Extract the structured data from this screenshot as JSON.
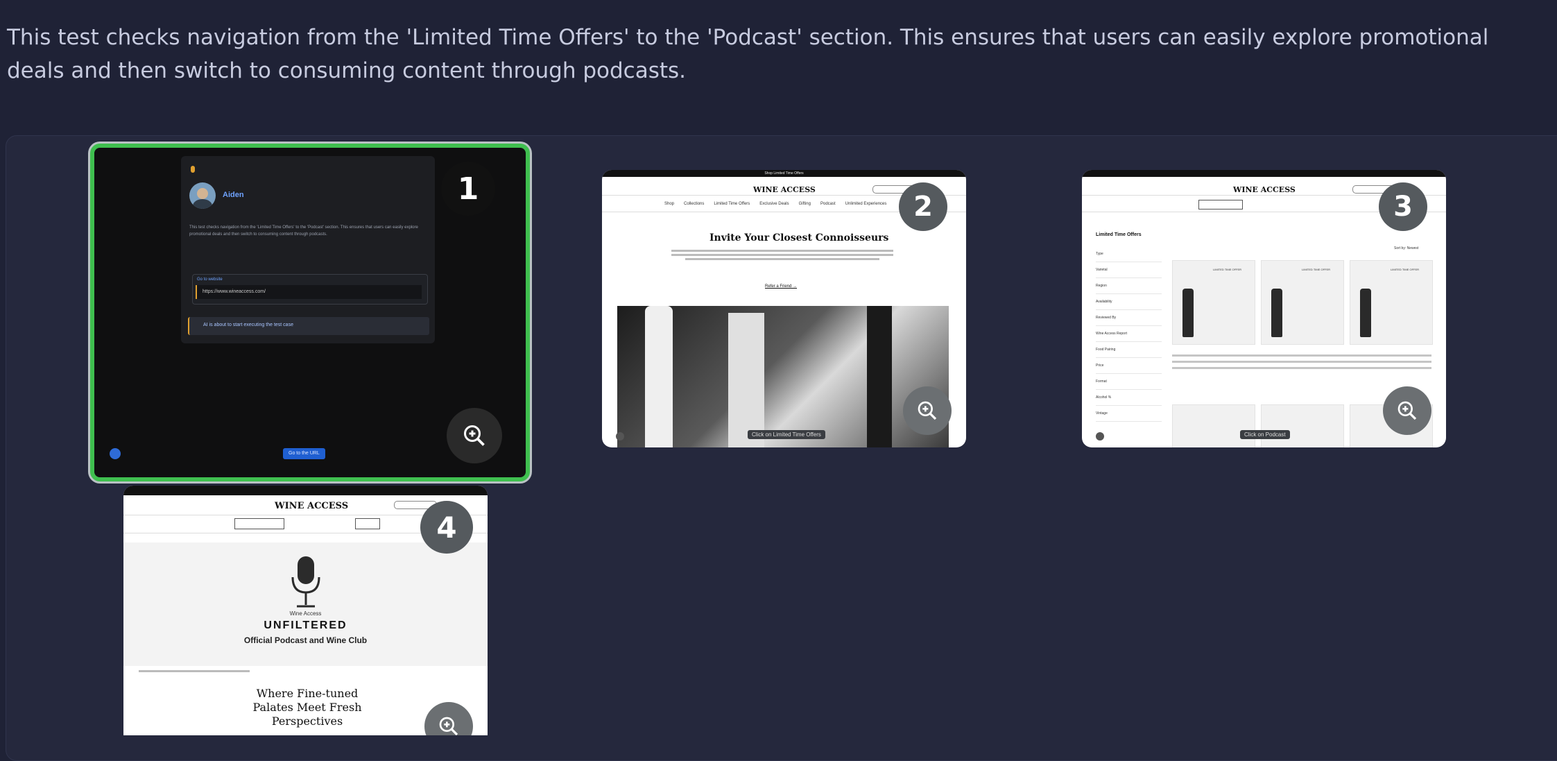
{
  "description": "This test checks navigation from the 'Limited Time Offers' to the 'Podcast' section. This ensures that users can easily explore promotional deals and then switch to consuming content through podcasts.",
  "steps": [
    {
      "number": "1",
      "chat": {
        "user": "Aiden",
        "text": "This test checks navigation from the 'Limited Time Offers' to the 'Podcast' section. This ensures that users can easily explore promotional deals and then switch to consuming content through podcasts.",
        "url_label": "Go to website",
        "url": "https://www.wineaccess.com/",
        "status": "AI is about to start executing the test case",
        "button": "Go to the URL"
      }
    },
    {
      "number": "2",
      "site": {
        "brand": "WINE ACCESS",
        "banner": "Shop Limited Time Offers",
        "nav": [
          "Shop",
          "Collections",
          "Limited Time Offers",
          "Exclusive Deals",
          "Gifting",
          "Podcast",
          "Unlimited Experiences"
        ],
        "headline": "Invite Your Closest Connoisseurs",
        "cta": "Refer a Friend →",
        "tooltip": "Click on Limited Time Offers"
      }
    },
    {
      "number": "3",
      "site": {
        "brand": "WINE ACCESS",
        "sidebar_title": "Limited Time Offers",
        "filters": [
          "Type",
          "Varietal",
          "Region",
          "Availability",
          "Reviewed By",
          "Wine Access Report",
          "Food Pairing",
          "Price",
          "Format",
          "Alcohol %",
          "Vintage"
        ],
        "sort": "Sort by: Newest",
        "card_tag": "LIMITED TIME OFFER",
        "tooltip": "Click on Podcast"
      }
    },
    {
      "number": "4",
      "site": {
        "brand": "WINE ACCESS",
        "podcast_small": "Wine Access",
        "podcast_title": "UNFILTERED",
        "podcast_sub": "Official Podcast and Wine Club",
        "headline": "Where Fine-tuned Palates Meet Fresh Perspectives"
      }
    }
  ],
  "colors": {
    "active_border": "#3fbf4f",
    "background": "#1f2236",
    "panel": "#25283d"
  }
}
